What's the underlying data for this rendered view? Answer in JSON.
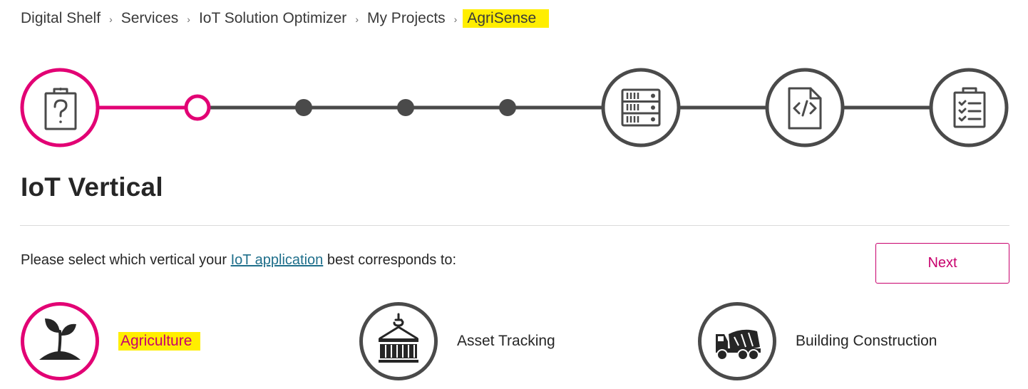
{
  "breadcrumb": {
    "items": [
      "Digital Shelf",
      "Services",
      "IoT Solution Optimizer",
      "My Projects"
    ],
    "separator": "›",
    "current": "AgriSense"
  },
  "stepper": {
    "steps": [
      {
        "icon": "clipboard-question-icon",
        "state": "active"
      },
      {
        "icon": "sub-step-dot",
        "state": "current"
      },
      {
        "icon": "sub-step-dot",
        "state": "pending"
      },
      {
        "icon": "sub-step-dot",
        "state": "pending"
      },
      {
        "icon": "sub-step-dot",
        "state": "pending"
      },
      {
        "icon": "server-rack-icon",
        "state": "pending"
      },
      {
        "icon": "code-file-icon",
        "state": "pending"
      },
      {
        "icon": "checklist-clipboard-icon",
        "state": "pending"
      }
    ],
    "colors": {
      "active": "#e20074",
      "pending": "#4a4a4a"
    }
  },
  "page": {
    "title": "IoT Vertical",
    "prompt_before": "Please select which vertical your ",
    "prompt_link": "IoT application",
    "prompt_after": " best corresponds to:",
    "next_label": "Next"
  },
  "verticals": [
    {
      "label": "Agriculture",
      "icon": "plant-sprout-icon",
      "selected": true
    },
    {
      "label": "Asset Tracking",
      "icon": "crane-container-icon",
      "selected": false
    },
    {
      "label": "Building Construction",
      "icon": "cement-mixer-truck-icon",
      "selected": false
    }
  ],
  "colors": {
    "accent": "#e20074",
    "highlight": "#ffee00",
    "link": "#1f6f8b",
    "dark": "#4a4a4a"
  }
}
